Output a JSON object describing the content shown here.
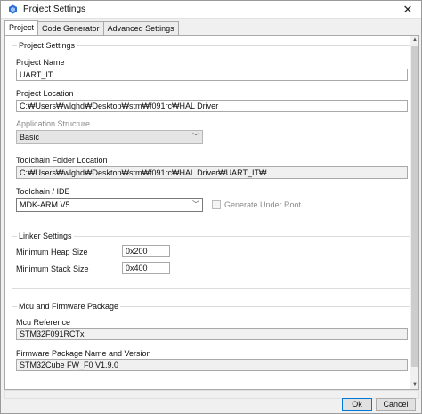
{
  "window": {
    "title": "Project Settings"
  },
  "tabs": [
    {
      "label": "Project"
    },
    {
      "label": "Code Generator"
    },
    {
      "label": "Advanced Settings"
    }
  ],
  "project_settings": {
    "group_title": "Project Settings",
    "project_name_label": "Project Name",
    "project_name_value": "UART_IT",
    "project_location_label": "Project Location",
    "project_location_value": "C:₩Users₩wlghd₩Desktop₩stm₩f091rc₩HAL Driver",
    "app_structure_label": "Application Structure",
    "app_structure_value": "Basic",
    "toolchain_folder_label": "Toolchain Folder Location",
    "toolchain_folder_value": "C:₩Users₩wlghd₩Desktop₩stm₩f091rc₩HAL Driver₩UART_IT₩",
    "toolchain_ide_label": "Toolchain / IDE",
    "toolchain_ide_value": "MDK-ARM V5",
    "generate_under_root_label": "Generate Under Root"
  },
  "linker_settings": {
    "group_title": "Linker Settings",
    "min_heap_label": "Minimum Heap Size",
    "min_heap_value": "0x200",
    "min_stack_label": "Minimum Stack Size",
    "min_stack_value": "0x400"
  },
  "mcu_firmware": {
    "group_title": "Mcu and Firmware Package",
    "mcu_reference_label": "Mcu Reference",
    "mcu_reference_value": "STM32F091RCTx",
    "firmware_label": "Firmware Package Name and Version",
    "firmware_value": "STM32Cube FW_F0 V1.9.0"
  },
  "buttons": {
    "ok": "Ok",
    "cancel": "Cancel"
  },
  "icons": {
    "app": "stm32cubemx-icon",
    "close": "close-icon",
    "chevron": "chevron-down-icon"
  },
  "colors": {
    "accent": "#0078d7",
    "icon_blue": "#2a6fd8"
  }
}
